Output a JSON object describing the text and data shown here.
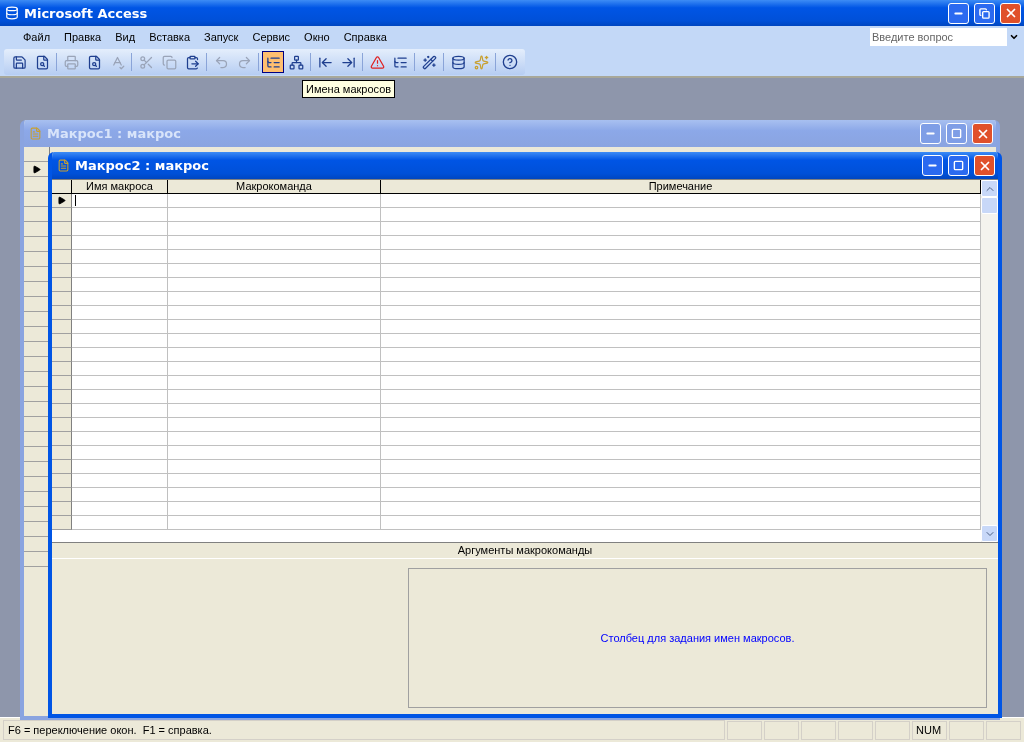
{
  "app": {
    "title": "Microsoft Access"
  },
  "menu": [
    {
      "label": "Файл"
    },
    {
      "label": "Правка"
    },
    {
      "label": "Вид"
    },
    {
      "label": "Вставка"
    },
    {
      "label": "Запуск"
    },
    {
      "label": "Сервис"
    },
    {
      "label": "Окно"
    },
    {
      "label": "Справка"
    }
  ],
  "help_search": {
    "placeholder": "Введите вопрос"
  },
  "toolbar": {
    "macro_names_on": true,
    "conditions_on": false
  },
  "tooltip": "Имена макросов",
  "windows": [
    {
      "title": "Макрос1 : макрос",
      "active": false
    },
    {
      "title": "Макрос2 : макрос",
      "active": true,
      "columns": [
        "Имя макроса",
        "Макрокоманда",
        "Примечание"
      ],
      "arguments_title": "Аргументы макрокоманды",
      "hint": "Столбец для задания имен макросов."
    }
  ],
  "status_bar": {
    "text": "F6 = переключение окон.  F1 = справка.",
    "indicators": [
      "NUM"
    ]
  }
}
